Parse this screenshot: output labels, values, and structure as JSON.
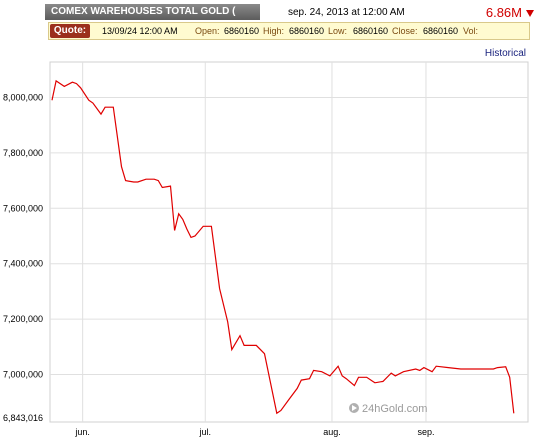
{
  "header": {
    "title": "COMEX WAREHOUSES TOTAL GOLD (",
    "datetime": "sep. 24, 2013 at 12:00 AM",
    "price": "6.86M"
  },
  "quote": {
    "label": "Quote:",
    "date": "13/09/24 12:00 AM",
    "open_label": "Open:",
    "open": "6860160",
    "high_label": "High:",
    "high": "6860160",
    "low_label": "Low:",
    "low": "6860160",
    "close_label": "Close:",
    "close": "6860160",
    "vol_label": "Vol:"
  },
  "historical_link": "Historical",
  "watermark": "24hGold.com",
  "colors": {
    "line": "#e00000",
    "grid": "#e0e0e0",
    "accent": "#d00000"
  },
  "chart_data": {
    "type": "line",
    "x_tick_labels": [
      "jun.",
      "jul.",
      "aug.",
      "sep."
    ],
    "x_tick_positions": [
      7.5,
      37.5,
      68.5,
      91.5
    ],
    "y_tick_labels": [
      "8,000,000",
      "7,800,000",
      "7,600,000",
      "7,400,000",
      "7,200,000",
      "7,000,000",
      "6,843,016"
    ],
    "y_tick_values": [
      8000000,
      7800000,
      7600000,
      7400000,
      7200000,
      7000000,
      6843016
    ],
    "ylim": [
      6843016,
      8110000
    ],
    "xlim": [
      0,
      115
    ],
    "grid": true,
    "series": [
      {
        "values": [
          [
            0,
            7990000
          ],
          [
            1,
            8060000
          ],
          [
            3,
            8040000
          ],
          [
            5,
            8055000
          ],
          [
            6,
            8050000
          ],
          [
            7,
            8035000
          ],
          [
            9,
            7990000
          ],
          [
            10,
            7980000
          ],
          [
            12,
            7940000
          ],
          [
            13,
            7965000
          ],
          [
            15,
            7965000
          ],
          [
            17,
            7750000
          ],
          [
            18,
            7700000
          ],
          [
            20,
            7695000
          ],
          [
            21,
            7695000
          ],
          [
            23,
            7705000
          ],
          [
            25,
            7705000
          ],
          [
            26,
            7700000
          ],
          [
            27,
            7675000
          ],
          [
            29,
            7680000
          ],
          [
            30,
            7520000
          ],
          [
            31,
            7580000
          ],
          [
            32,
            7560000
          ],
          [
            33,
            7525000
          ],
          [
            34,
            7495000
          ],
          [
            35,
            7500000
          ],
          [
            37,
            7535000
          ],
          [
            39,
            7535000
          ],
          [
            41,
            7310000
          ],
          [
            43,
            7190000
          ],
          [
            44,
            7090000
          ],
          [
            46,
            7140000
          ],
          [
            47,
            7105000
          ],
          [
            48,
            7105000
          ],
          [
            50,
            7105000
          ],
          [
            52,
            7075000
          ],
          [
            55,
            6860000
          ],
          [
            56,
            6870000
          ],
          [
            58,
            6910000
          ],
          [
            60,
            6950000
          ],
          [
            61,
            6980000
          ],
          [
            63,
            6985000
          ],
          [
            64,
            7015000
          ],
          [
            66,
            7010000
          ],
          [
            68,
            6995000
          ],
          [
            70,
            7030000
          ],
          [
            71,
            6995000
          ],
          [
            72,
            6985000
          ],
          [
            74,
            6960000
          ],
          [
            75,
            6990000
          ],
          [
            77,
            6990000
          ],
          [
            79,
            6970000
          ],
          [
            81,
            6975000
          ],
          [
            83,
            7005000
          ],
          [
            84,
            6995000
          ],
          [
            86,
            7010000
          ],
          [
            89,
            7020000
          ],
          [
            90,
            7015000
          ],
          [
            91,
            7025000
          ],
          [
            93,
            7010000
          ],
          [
            94,
            7030000
          ],
          [
            97,
            7025000
          ],
          [
            100,
            7020000
          ],
          [
            102,
            7020000
          ],
          [
            104,
            7020000
          ],
          [
            106,
            7020000
          ],
          [
            108,
            7020000
          ],
          [
            109,
            7025000
          ],
          [
            111,
            7028000
          ],
          [
            112,
            6990000
          ],
          [
            113,
            6860160
          ]
        ]
      }
    ]
  }
}
